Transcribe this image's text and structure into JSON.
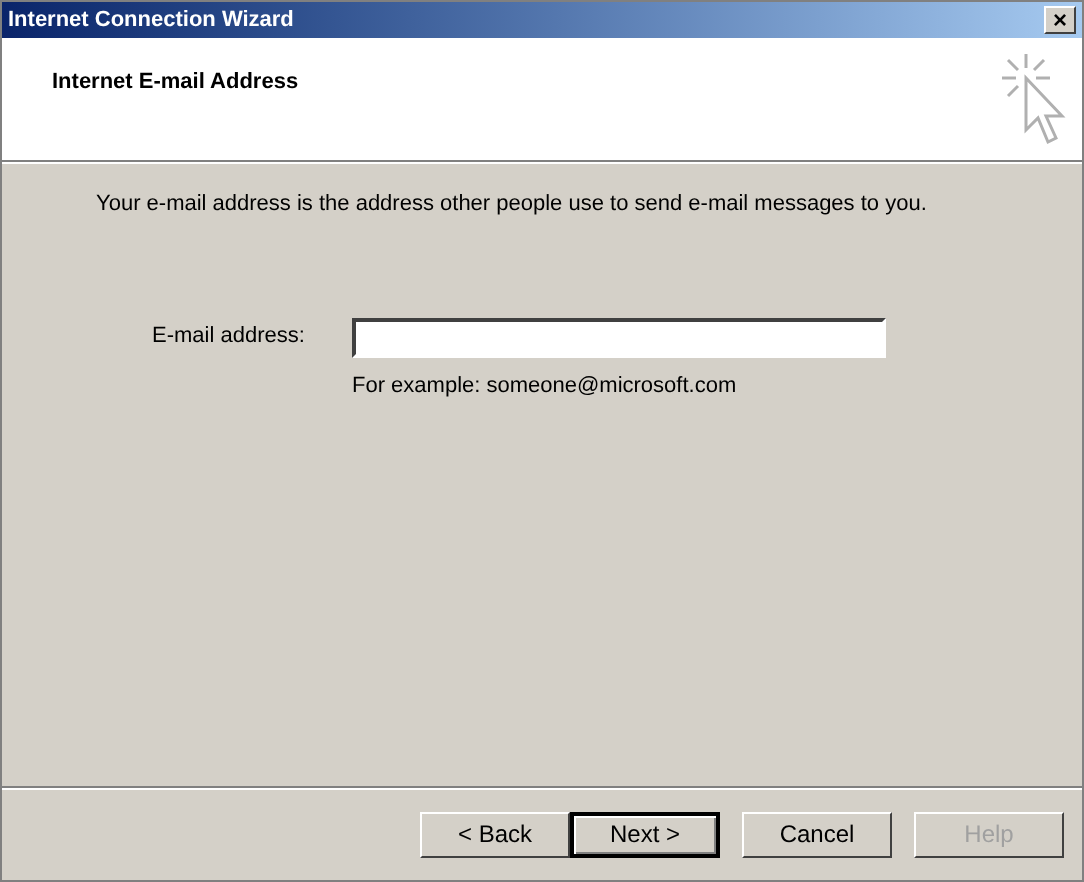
{
  "window": {
    "title": "Internet Connection Wizard",
    "close": "×"
  },
  "header": {
    "title": "Internet E-mail Address"
  },
  "intro": "Your e-mail address is the address other people use to send e-mail messages to you.",
  "email_field": {
    "label": "E-mail address:",
    "hint": "For example: someone@microsoft.com"
  },
  "buttons": [
    {
      "label": "< Back",
      "default": false,
      "disabled": false
    },
    {
      "label": "Next >",
      "default": true,
      "disabled": false
    },
    {
      "label": "Cancel",
      "default": false,
      "disabled": false
    },
    {
      "label": "Help",
      "default": false,
      "disabled": true
    }
  ]
}
